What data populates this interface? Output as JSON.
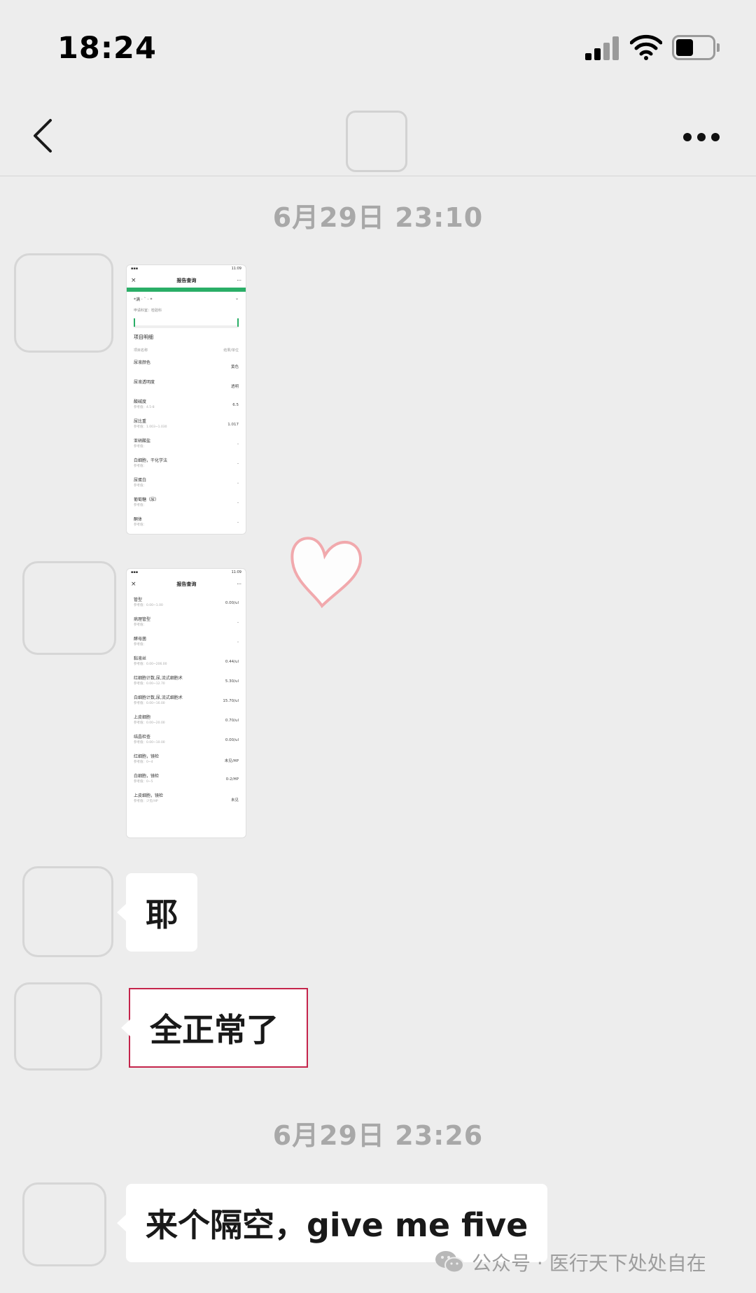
{
  "status_bar": {
    "time": "18:24",
    "icons": [
      "cellular-signal-icon",
      "wifi-icon",
      "battery-icon"
    ]
  },
  "nav": {
    "back_icon": "chevron-left-icon",
    "more_icon": "ellipsis-icon"
  },
  "timestamps": [
    "6月29日 23:10",
    "6月29日 23:26"
  ],
  "image_messages": [
    {
      "status_time": "11:09",
      "title": "报告查询",
      "patient": "*满 · ` · *",
      "dept": "申请科室：检验科",
      "section": "项目明细",
      "col_item": "项目名称",
      "col_result": "结果/单位",
      "rows": [
        {
          "name": "尿液颜色",
          "ref": "",
          "value": "黄色"
        },
        {
          "name": "尿液透明度",
          "ref": "",
          "value": "透明"
        },
        {
          "name": "酸碱度",
          "ref": "参考值：4.5-8",
          "value": "6.5"
        },
        {
          "name": "尿比重",
          "ref": "参考值：1.003~1.030",
          "value": "1.017"
        },
        {
          "name": "亚硝酸盐",
          "ref": "参考值：",
          "value": "-"
        },
        {
          "name": "白细胞，干化学法",
          "ref": "参考值：",
          "value": "-"
        },
        {
          "name": "尿蛋白",
          "ref": "参考值：",
          "value": "-"
        },
        {
          "name": "葡萄糖（尿）",
          "ref": "参考值：",
          "value": "-"
        },
        {
          "name": "酮体",
          "ref": "参考值：",
          "value": "-"
        }
      ]
    },
    {
      "status_time": "11:09",
      "title": "报告查询",
      "rows": [
        {
          "name": "管型",
          "ref": "参考值：0.00~1.00",
          "value": "0.00/ul"
        },
        {
          "name": "病理管型",
          "ref": "参考值：",
          "value": "-"
        },
        {
          "name": "酵母菌",
          "ref": "参考值：",
          "value": "-"
        },
        {
          "name": "黏液丝",
          "ref": "参考值：0.00~206.00",
          "value": "0.44/ul"
        },
        {
          "name": "红细胞计数,尿,流式细胞术",
          "ref": "参考值：0.00~12.70",
          "value": "5.30/ul"
        },
        {
          "name": "白细胞计数,尿,流式细胞术",
          "ref": "参考值：0.00~16.00",
          "value": "15.70/ul"
        },
        {
          "name": "上皮细胞",
          "ref": "参考值：0.00~20.00",
          "value": "0.70/ul"
        },
        {
          "name": "结晶检查",
          "ref": "参考值：0.00~10.00",
          "value": "0.00/ul"
        },
        {
          "name": "红细胞，镜检",
          "ref": "参考值：0~4",
          "value": "未见/HP"
        },
        {
          "name": "白细胞，镜检",
          "ref": "参考值：0~5",
          "value": "0-2/HP"
        },
        {
          "name": "上皮细胞，镜检",
          "ref": "参考值：少见/HP",
          "value": "未见"
        }
      ]
    }
  ],
  "text_messages": [
    "耶",
    "全正常了",
    "来个隔空，give me five"
  ],
  "decorations": {
    "heart_color": "#f1a9ad"
  },
  "watermark": {
    "icon": "wechat-icon",
    "text": "公众号 · 医行天下处处自在"
  }
}
